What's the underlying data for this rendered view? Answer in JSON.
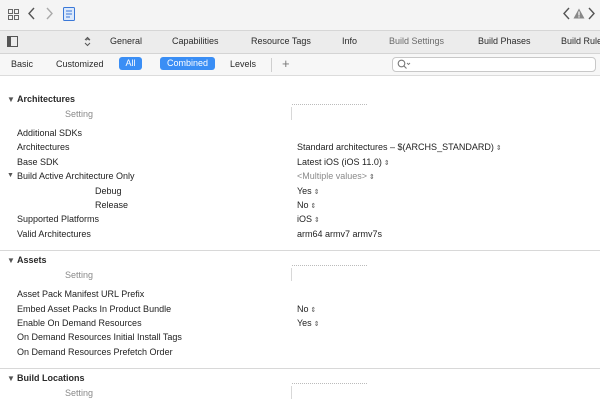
{
  "toolbar": {
    "icons": [
      "grid-icon",
      "back-arrow-icon",
      "forward-arrow-icon",
      "swift-file-icon",
      "warning-icon"
    ]
  },
  "editor_tabs": [
    {
      "label": "General"
    },
    {
      "label": "Capabilities"
    },
    {
      "label": "Resource Tags"
    },
    {
      "label": "Info"
    },
    {
      "label": "Build Settings"
    },
    {
      "label": "Build Phases"
    },
    {
      "label": "Build Rule"
    }
  ],
  "filter": {
    "basic": "Basic",
    "customized": "Customized",
    "all": "All",
    "combined": "Combined",
    "levels": "Levels",
    "add": "+",
    "search_icon": "Q",
    "active_color": "#3a8ef5"
  },
  "sections": [
    {
      "title": "Architectures",
      "column_header": "Setting",
      "rows": [
        {
          "name": "Additional SDKs",
          "value": ""
        },
        {
          "name": "Architectures",
          "value": "Standard architectures  –  $(ARCHS_STANDARD)",
          "stepper": true
        },
        {
          "name": "Base SDK",
          "value": "Latest iOS (iOS 11.0)",
          "stepper": true
        },
        {
          "name": "Build Active Architecture Only",
          "value": "<Multiple values>",
          "stepper": true,
          "muted": true,
          "expandable": true
        },
        {
          "name": "Debug",
          "value": "Yes",
          "stepper": true,
          "indent": 2
        },
        {
          "name": "Release",
          "value": "No",
          "stepper": true,
          "indent": 2
        },
        {
          "name": "Supported Platforms",
          "value": "iOS",
          "stepper": true
        },
        {
          "name": "Valid Architectures",
          "value": "arm64 armv7 armv7s"
        }
      ]
    },
    {
      "title": "Assets",
      "column_header": "Setting",
      "rows": [
        {
          "name": "Asset Pack Manifest URL Prefix",
          "value": ""
        },
        {
          "name": "Embed Asset Packs In Product Bundle",
          "value": "No",
          "stepper": true
        },
        {
          "name": "Enable On Demand Resources",
          "value": "Yes",
          "stepper": true
        },
        {
          "name": "On Demand Resources Initial Install Tags",
          "value": ""
        },
        {
          "name": "On Demand Resources Prefetch Order",
          "value": ""
        }
      ]
    },
    {
      "title": "Build Locations",
      "column_header": "Setting",
      "rows": []
    }
  ]
}
